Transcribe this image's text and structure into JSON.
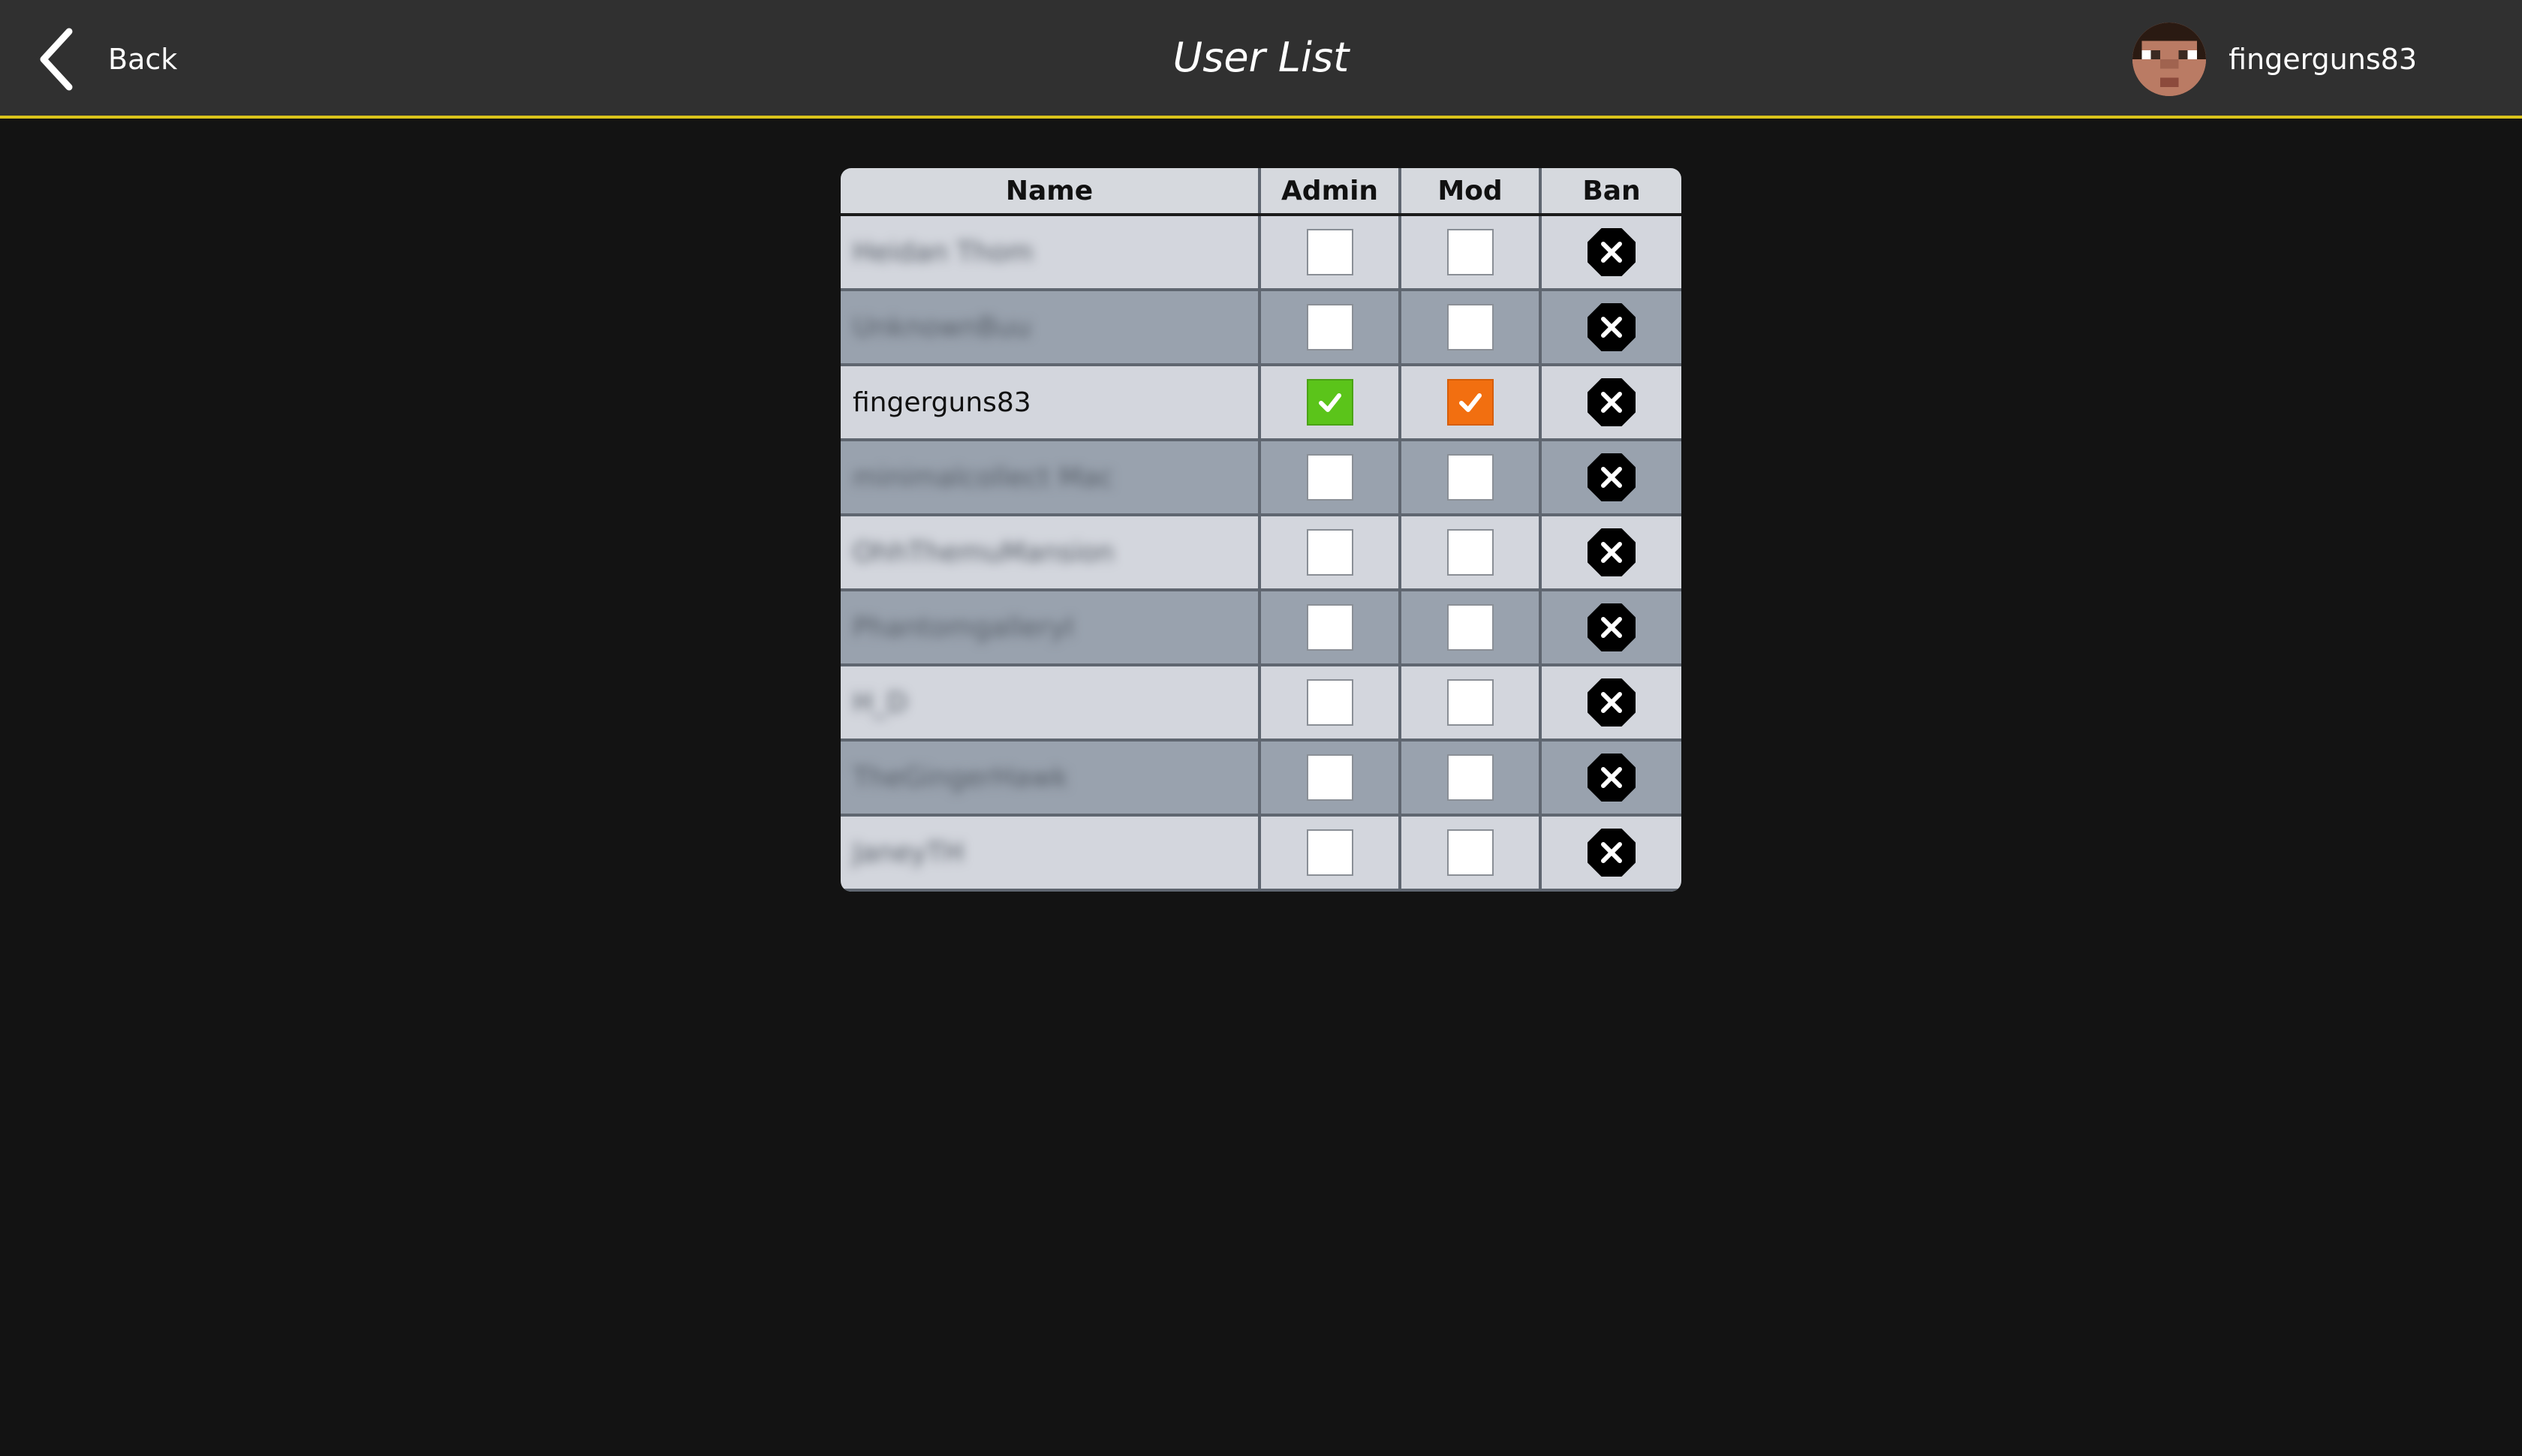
{
  "header": {
    "back_label": "Back",
    "title": "User List",
    "username": "fingerguns83"
  },
  "colors": {
    "accent_line": "#d9c21b",
    "admin_checked": "#5bc41a",
    "mod_checked": "#f26f10"
  },
  "table": {
    "columns": [
      "Name",
      "Admin",
      "Mod",
      "Ban"
    ],
    "rows": [
      {
        "name": "Heidan Thom",
        "blurred": true,
        "admin": false,
        "mod": false
      },
      {
        "name": "UnknownBuu",
        "blurred": true,
        "admin": false,
        "mod": false
      },
      {
        "name": "fingerguns83",
        "blurred": false,
        "admin": true,
        "mod": true
      },
      {
        "name": "minimalcollect Mac",
        "blurred": true,
        "admin": false,
        "mod": false
      },
      {
        "name": "OhhThemuMansion",
        "blurred": true,
        "admin": false,
        "mod": false
      },
      {
        "name": "PhantomgalleryI",
        "blurred": true,
        "admin": false,
        "mod": false
      },
      {
        "name": "H_D",
        "blurred": true,
        "admin": false,
        "mod": false
      },
      {
        "name": "TheGingerHawk",
        "blurred": true,
        "admin": false,
        "mod": false
      },
      {
        "name": "JaneyTH",
        "blurred": true,
        "admin": false,
        "mod": false
      }
    ]
  }
}
